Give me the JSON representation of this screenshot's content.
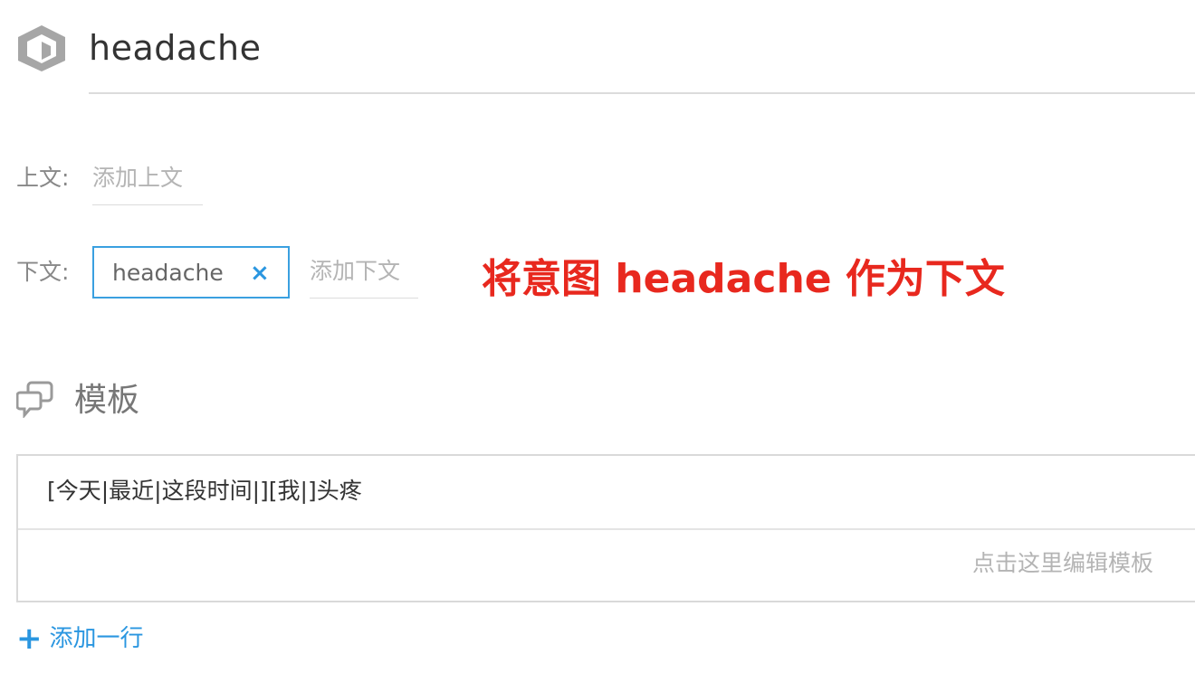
{
  "intent": {
    "icon": "cube-icon",
    "name": "headache"
  },
  "context": {
    "above_label": "上文:",
    "above_add_placeholder": "添加上文",
    "below_label": "下文:",
    "below_tags": [
      {
        "label": "headache",
        "remove_icon": "×"
      }
    ],
    "below_add_placeholder": "添加下文"
  },
  "annotation": {
    "text": "将意图 headache 作为下文",
    "color": "#e8281e"
  },
  "templates": {
    "icon": "chat-bubble-icon",
    "title": "模板",
    "rows": [
      {
        "pattern": "[今天|最近|这段时间|][我|]头疼"
      }
    ],
    "edit_hint": "点击这里编辑模板",
    "add_row_icon": "+",
    "add_row_label": "添加一行"
  },
  "colors": {
    "accent": "#2a96e0",
    "tag_border": "#3aa0e0",
    "placeholder": "#b4b4b4"
  }
}
